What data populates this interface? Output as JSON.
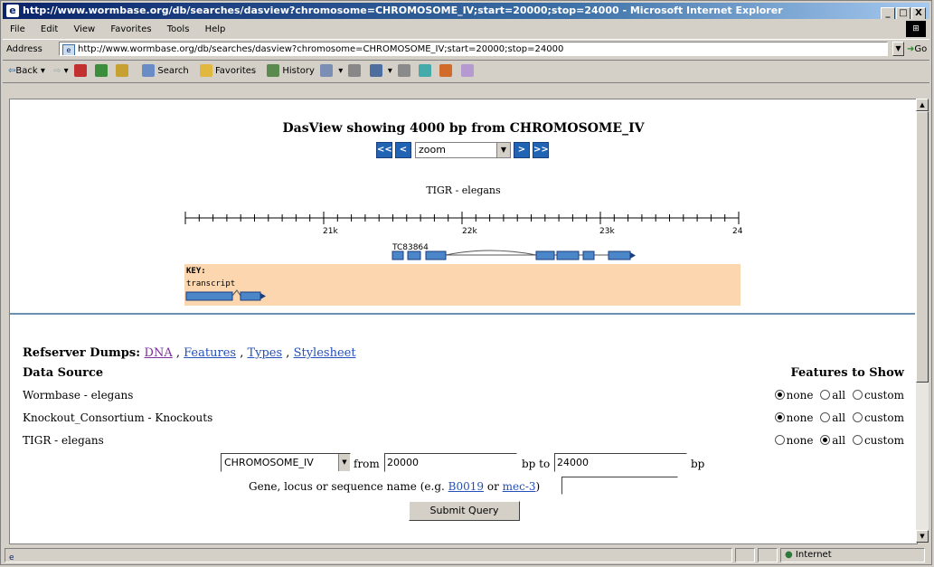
{
  "window": {
    "title": "http://www.wormbase.org/db/searches/dasview?chromosome=CHROMOSOME_IV;start=20000;stop=24000 - Microsoft Internet Explorer",
    "minimize": "_",
    "maximize": "□",
    "close": "X"
  },
  "menu": [
    "File",
    "Edit",
    "View",
    "Favorites",
    "Tools",
    "Help"
  ],
  "address": {
    "label": "Address",
    "url": "http://www.wormbase.org/db/searches/dasview?chromosome=CHROMOSOME_IV;start=20000;stop=24000",
    "go": "Go"
  },
  "toolbar": {
    "back": "Back",
    "search": "Search",
    "favorites": "Favorites",
    "history": "History"
  },
  "page": {
    "heading": "DasView showing 4000 bp from CHROMOSOME_IV",
    "nav": {
      "first": "<<",
      "prev": "<",
      "zoom": "zoom",
      "next": ">",
      "last": ">>"
    },
    "track_title": "TIGR - elegans",
    "ruler_labels": [
      "21k",
      "22k",
      "23k",
      "24"
    ],
    "feature_label": "TC83864",
    "key_title": "KEY:",
    "key_item": "transcript",
    "refserver_label": "Refserver Dumps:",
    "refserver_links": [
      "DNA",
      "Features",
      "Types",
      "Stylesheet"
    ],
    "data_source_header": "Data Source",
    "features_header": "Features to Show",
    "sources": [
      {
        "name": "Wormbase - elegans",
        "selected": "none"
      },
      {
        "name": "Knockout_Consortium - Knockouts",
        "selected": "none"
      },
      {
        "name": "TIGR - elegans",
        "selected": "all"
      }
    ],
    "radio_labels": [
      "none",
      "all",
      "custom"
    ],
    "chromosome": "CHROMOSOME_IV",
    "from_label": "from",
    "from_value": "20000",
    "to_label": "bp to",
    "to_value": "24000",
    "bp_label": "bp",
    "gene_label_pre": "Gene, locus or sequence name (e.g.",
    "gene_example1": "B0019",
    "gene_or": "or",
    "gene_example2": "mec-3",
    "gene_close": ")",
    "submit": "Submit Query"
  },
  "status": {
    "zone": "Internet"
  },
  "colors": {
    "feature": "#4a86c8",
    "key_bg": "#fbd6ae",
    "nav_button": "#2264b4",
    "link": "#2550b8"
  }
}
